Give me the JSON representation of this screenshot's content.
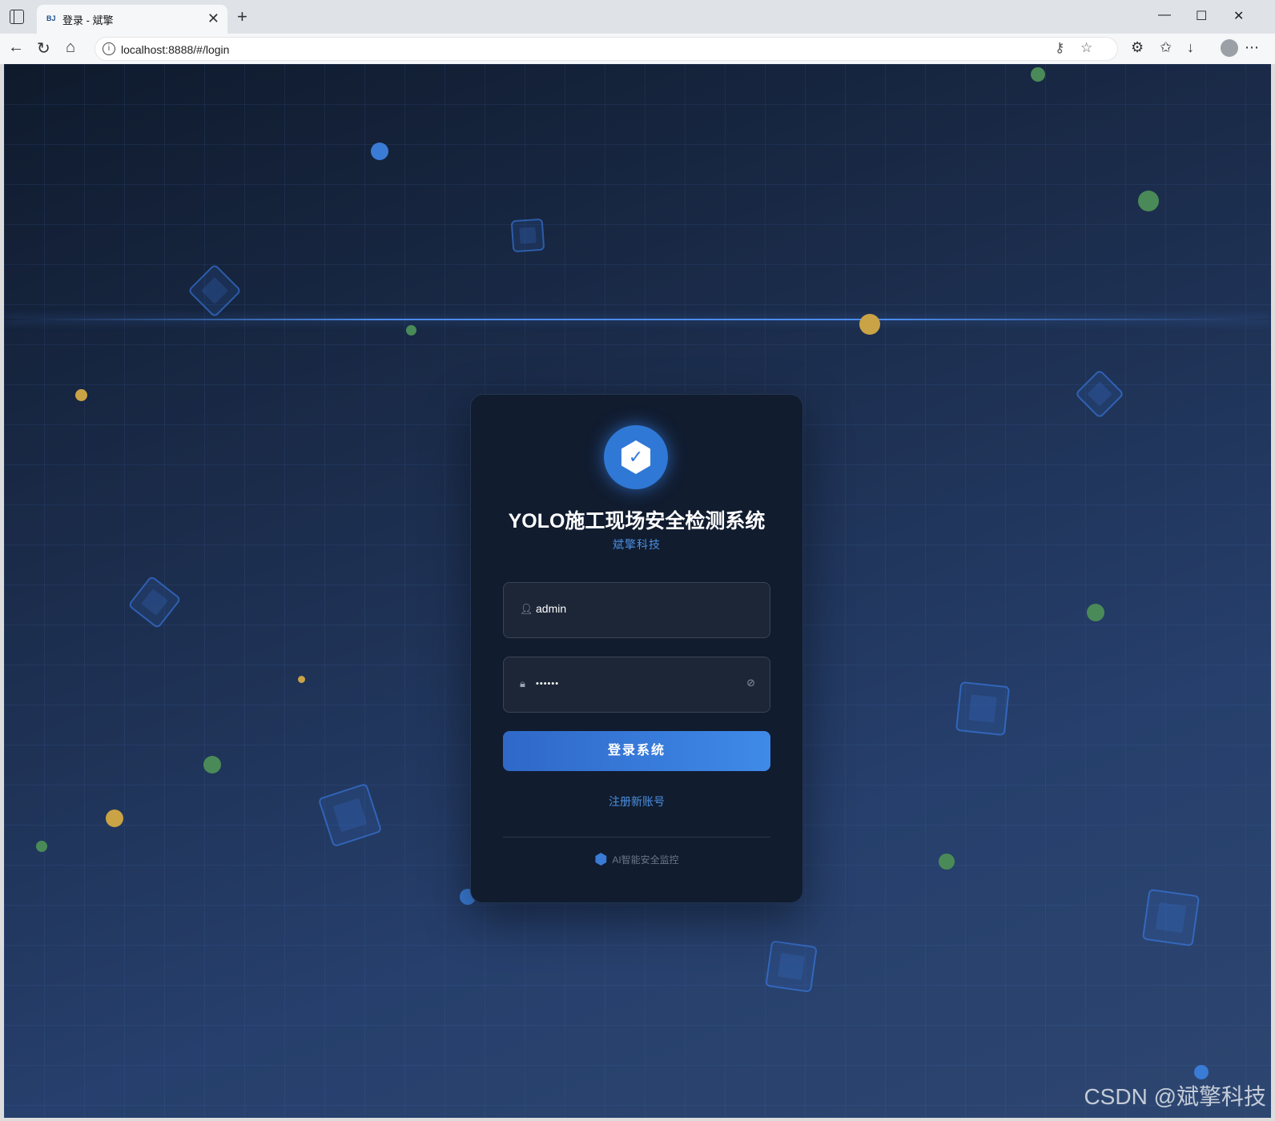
{
  "browser": {
    "tab_favicon": "BJ",
    "tab_title": "登录 - 斌擎",
    "url": "localhost:8888/#/login"
  },
  "login": {
    "title": "YOLO施工现场安全检测系统",
    "subtitle": "斌擎科技",
    "username_value": "admin",
    "password_value": "••••••",
    "login_button": "登录系统",
    "register_link": "注册新账号",
    "footer_text": "AI智能安全监控"
  },
  "watermark": "CSDN @斌擎科技",
  "icons": {
    "logo": "shield-check-icon",
    "user": "user-icon",
    "lock": "lock-icon",
    "eye": "eye-off-icon"
  },
  "colors": {
    "accent": "#3a7bd5",
    "card_bg": "#111c2f",
    "link": "#4a8fe0"
  }
}
